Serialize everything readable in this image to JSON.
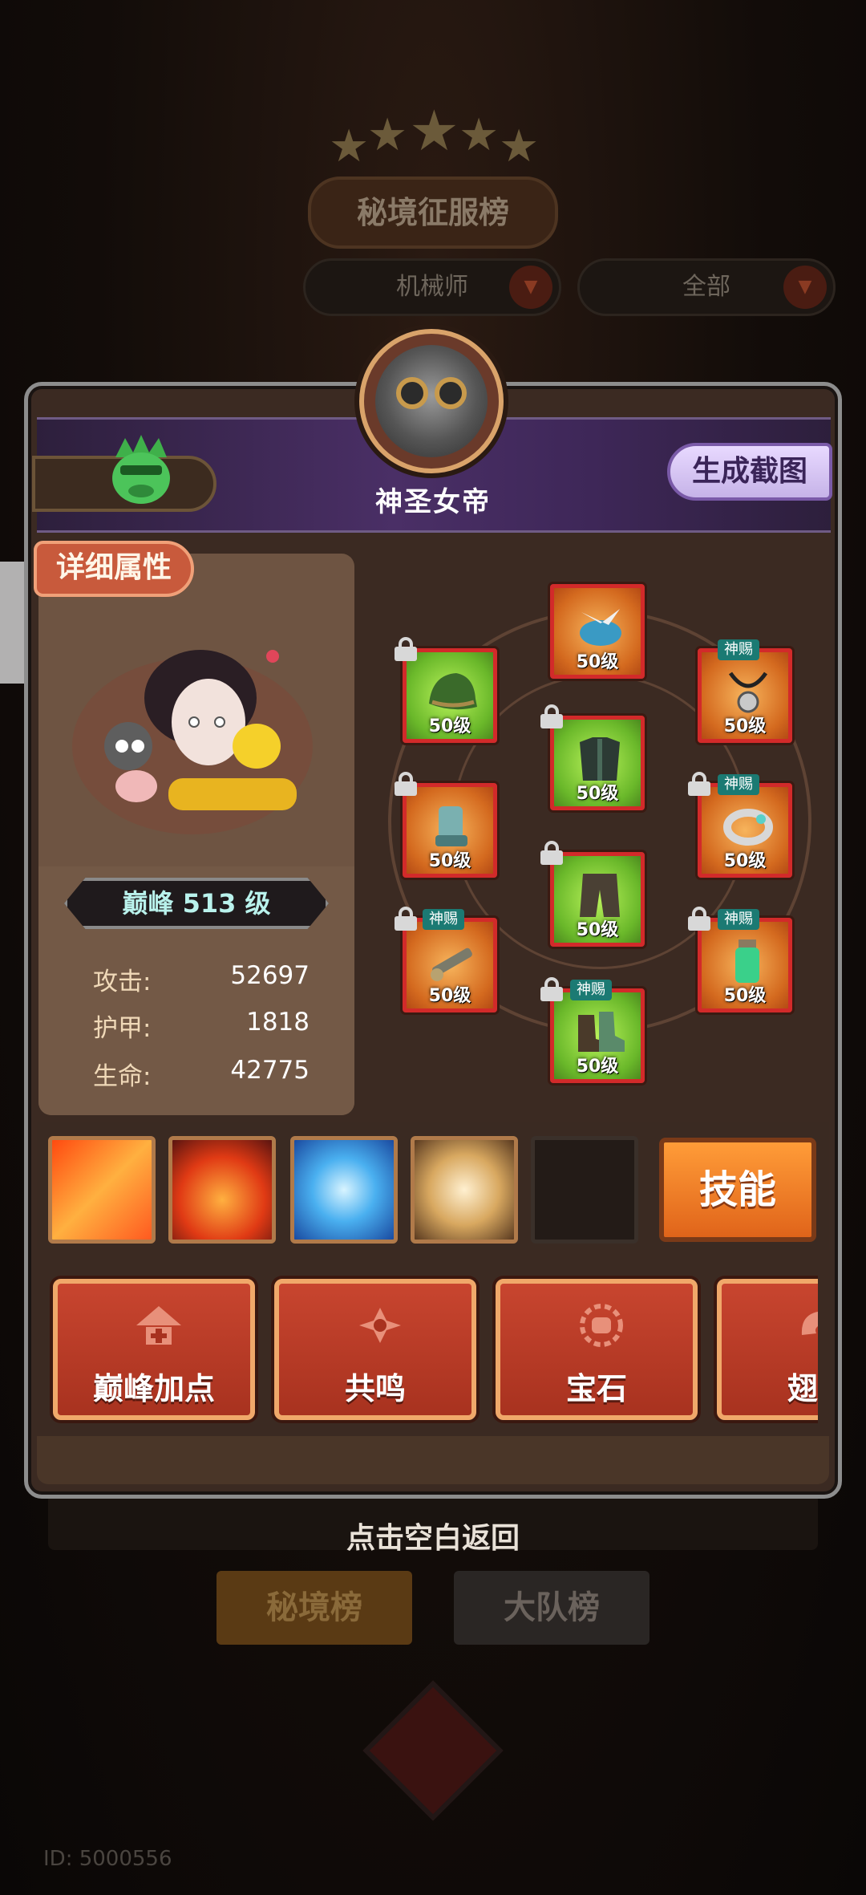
{
  "background": {
    "title": "秘境征服榜",
    "filter_class": "机械师",
    "filter_scope": "全部",
    "tab_rank_secret": "秘境榜",
    "tab_rank_team": "大队榜",
    "user_id": "ID: 5000556",
    "dismiss_hint": "点击空白返回"
  },
  "player": {
    "name": "神圣女帝",
    "screenshot_button": "生成截图"
  },
  "detail": {
    "tag": "详细属性",
    "rank_label": "巅峰 513 级",
    "stats": [
      {
        "key": "攻击:",
        "value": "52697"
      },
      {
        "key": "护甲:",
        "value": "1818"
      },
      {
        "key": "生命:",
        "value": "42775"
      }
    ]
  },
  "equipment": {
    "level_text": "50级",
    "god_tag": "神赐",
    "slots": [
      {
        "name": "helmet",
        "rarity": "green",
        "god": false,
        "locked": true
      },
      {
        "name": "wing-ornament",
        "rarity": "gold",
        "god": false,
        "locked": false
      },
      {
        "name": "necklace",
        "rarity": "gold",
        "god": true,
        "locked": false
      },
      {
        "name": "gloves",
        "rarity": "gold",
        "god": false,
        "locked": true
      },
      {
        "name": "armor",
        "rarity": "green",
        "god": false,
        "locked": true
      },
      {
        "name": "ring",
        "rarity": "gold",
        "god": true,
        "locked": true
      },
      {
        "name": "weapon",
        "rarity": "gold",
        "god": true,
        "locked": true
      },
      {
        "name": "pants",
        "rarity": "green",
        "god": false,
        "locked": true
      },
      {
        "name": "potion",
        "rarity": "gold",
        "god": true,
        "locked": true
      },
      {
        "name": "boots",
        "rarity": "green",
        "god": true,
        "locked": true
      }
    ]
  },
  "skills": {
    "button_label": "技能",
    "icons": [
      "fire-slash-icon",
      "flame-burst-icon",
      "ice-crystal-icon",
      "whirlwind-icon",
      "empty-slot"
    ]
  },
  "functions": [
    {
      "label": "巅峰加点",
      "icon": "peak-up-icon"
    },
    {
      "label": "共鸣",
      "icon": "resonance-icon"
    },
    {
      "label": "宝石",
      "icon": "gem-icon"
    },
    {
      "label": "翅膀",
      "icon": "wing-icon"
    }
  ],
  "colors": {
    "panel_bg": "#3b2a22",
    "accent_red": "#d22a2a",
    "skill_button": "#e0641a",
    "god_tag": "#1b7a73"
  }
}
